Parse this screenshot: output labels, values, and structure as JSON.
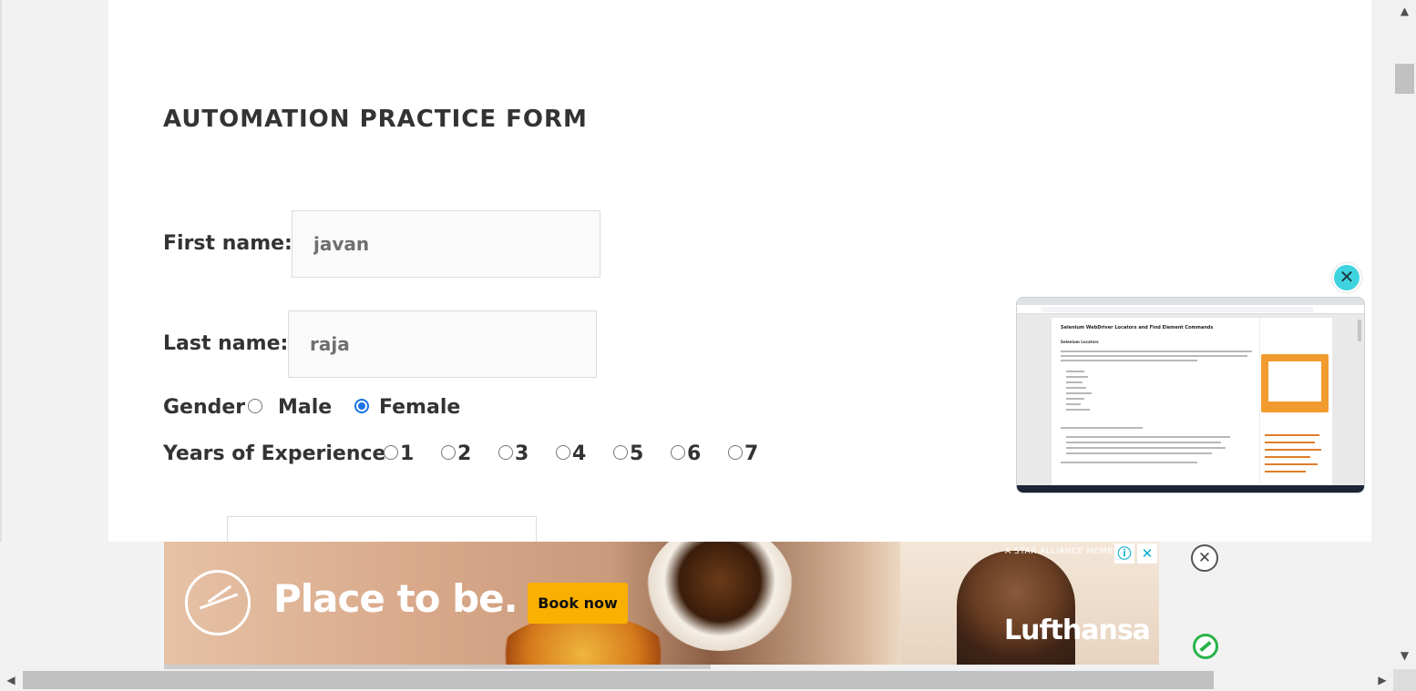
{
  "form": {
    "title": "AUTOMATION PRACTICE FORM",
    "first_name": {
      "label": "First name:",
      "value": "javan"
    },
    "last_name": {
      "label": "Last name:",
      "value": "raja"
    },
    "gender": {
      "label": "Gender",
      "options": [
        "Male",
        "Female"
      ],
      "selected": "Female"
    },
    "experience": {
      "label": "Years of Experience",
      "options": [
        "1",
        "2",
        "3",
        "4",
        "5",
        "6",
        "7"
      ],
      "selected": null
    }
  },
  "video_preview": {
    "close_glyph": "✕",
    "page_title": "Selenium WebDriver Locators and Find Element Commands",
    "page_subtitle": "Selenium Locators"
  },
  "ad": {
    "headline": "Place to be.",
    "cta_label": "Book now",
    "tagline": "A STAR ALLIANCE MEMBER",
    "brand": "Lufthansa",
    "info_glyph": "ⓘ",
    "close_glyph": "✕",
    "dismiss_glyph": "✕"
  },
  "scrollbars": {
    "up_glyph": "▲",
    "down_glyph": "▼",
    "left_glyph": "◀",
    "right_glyph": "▶"
  },
  "colors": {
    "accent_radio": "#1a73e8",
    "ad_cta": "#f9b000",
    "video_close": "#3fd3e0"
  }
}
